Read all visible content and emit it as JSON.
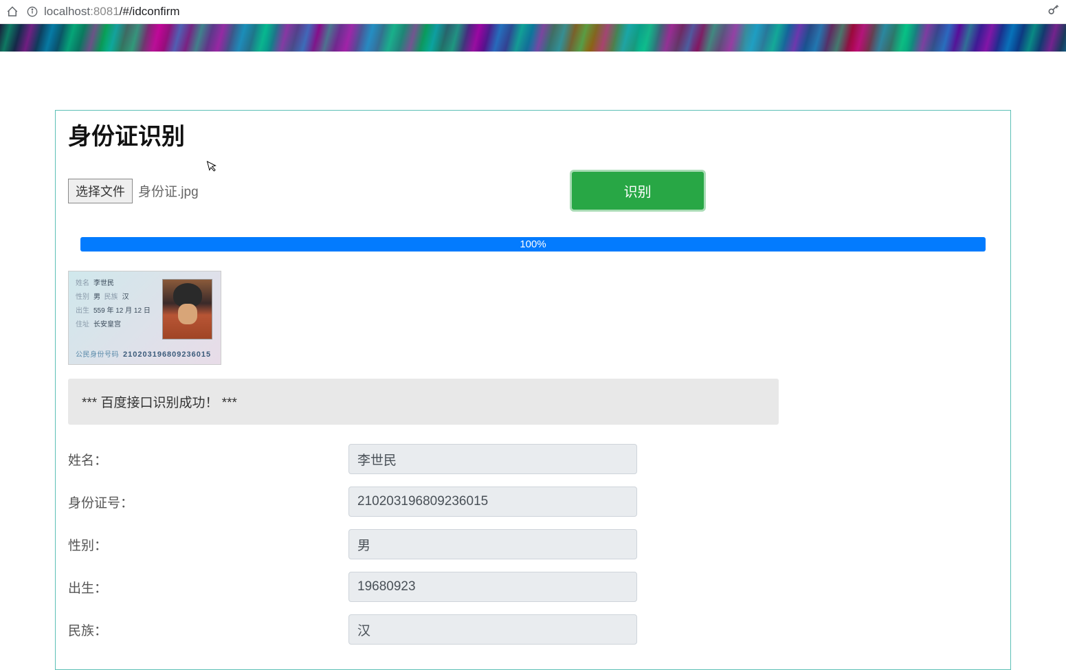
{
  "browser": {
    "url_host": "localhost",
    "url_port": ":8081",
    "url_path": "/#/idconfirm"
  },
  "page": {
    "title": "身份证识别"
  },
  "upload": {
    "choose_file_label": "选择文件",
    "file_name": "身份证.jpg",
    "recognize_label": "识别"
  },
  "progress": {
    "text": "100%"
  },
  "id_card_preview": {
    "name_label": "姓名",
    "name_value": "李世民",
    "sex_label": "性别",
    "sex_value": "男",
    "nation_label": "民族",
    "nation_value": "汉",
    "birth_label": "出生",
    "birth_value": "559 年 12 月 12 日",
    "address_label": "住址",
    "address_value": "长安皇宫",
    "idnum_label": "公民身份号码",
    "idnum_value": "210203196809236015"
  },
  "status": {
    "message": "***  百度接口识别成功！  ***"
  },
  "form": {
    "fields": {
      "name": {
        "label": "姓名：",
        "value": "李世民"
      },
      "idnum": {
        "label": "身份证号：",
        "value": "210203196809236015"
      },
      "sex": {
        "label": "性别：",
        "value": "男"
      },
      "birth": {
        "label": "出生：",
        "value": "19680923"
      },
      "nation": {
        "label": "民族：",
        "value": "汉"
      }
    }
  }
}
